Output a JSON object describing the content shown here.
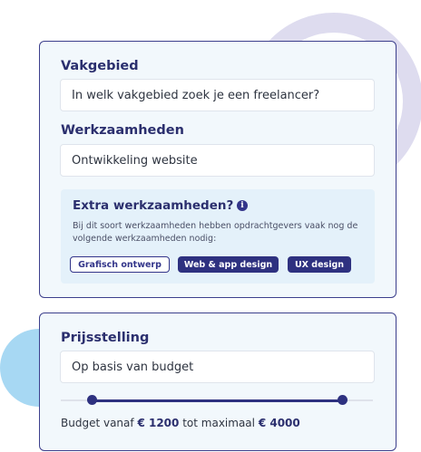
{
  "form": {
    "field_label": "Vakgebied",
    "field_placeholder": "In welk vakgebied zoek je een freelancer?",
    "tasks_label": "Werkzaamheden",
    "tasks_value": "Ontwikkeling website",
    "extra": {
      "title": "Extra werkzaamheden?",
      "info_icon": "info-icon",
      "description": "Bij dit soort werkzaamheden hebben opdrachtgevers vaak nog de volgende werkzaamheden nodig:",
      "chips": [
        {
          "label": "Grafisch ontwerp",
          "selected": false
        },
        {
          "label": "Web & app design",
          "selected": true
        },
        {
          "label": "UX design",
          "selected": true
        }
      ]
    }
  },
  "pricing": {
    "label": "Prijsstelling",
    "value": "Op basis van budget",
    "slider": {
      "min_fraction": 0.1,
      "max_fraction": 0.9
    },
    "budget_prefix": "Budget vanaf",
    "budget_min": "€ 1200",
    "budget_middle": "tot maximaal",
    "budget_max": "€ 4000"
  },
  "colors": {
    "accent": "#2e3180",
    "card_background": "#f2f8fc",
    "ring_decoration": "#dedcef",
    "blob_decoration": "#a7d8f3"
  }
}
